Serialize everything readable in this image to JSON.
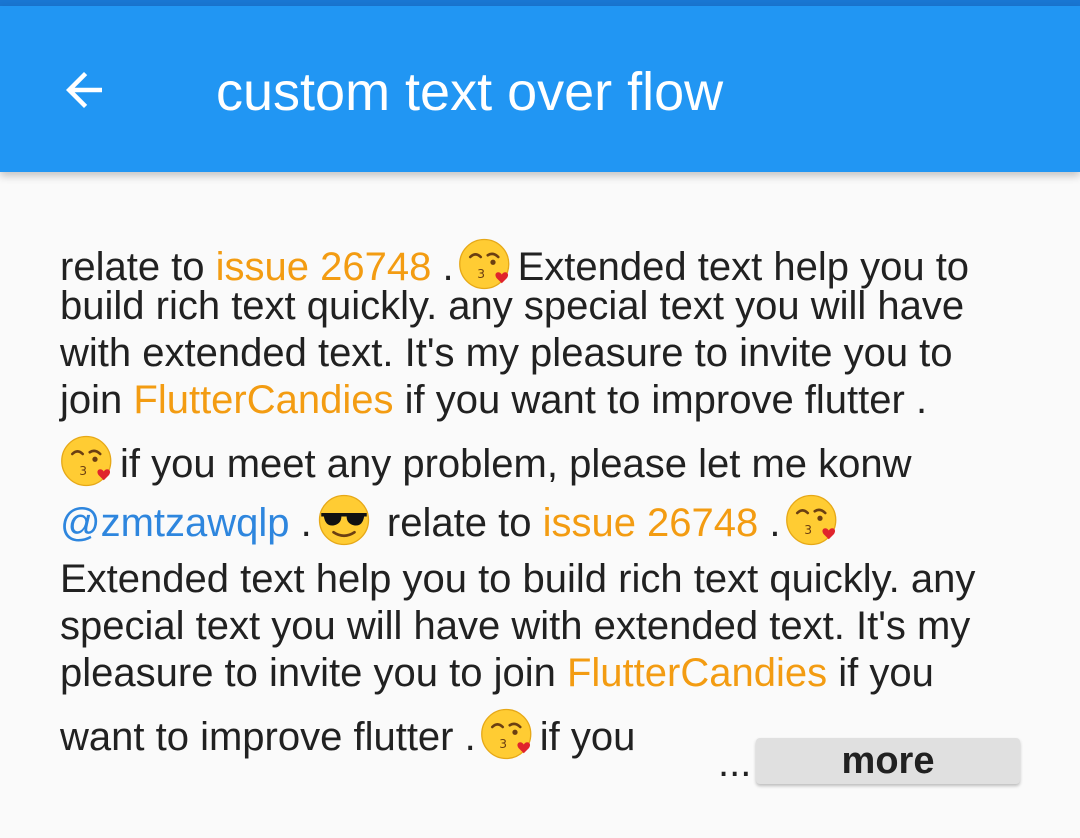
{
  "app_bar": {
    "title": "custom text over flow",
    "back_icon": "arrow-back-icon",
    "color": "#2196f3"
  },
  "content": {
    "text_color": "#212121",
    "link_color_orange": "#f39c12",
    "link_color_blue": "#2e86de",
    "l1_a": "relate to ",
    "l1_link": "issue 26748",
    "l1_b": " .",
    "l1_c": "Extended text help you to",
    "l2": "build rich text quickly. any special text you will have",
    "l3": "with extended text. It's my pleasure to invite you to",
    "l4_a": "join ",
    "l4_link": "FlutterCandies",
    "l4_b": " if you want to improve flutter .",
    "l5_b": "if you meet any problem, please let me konw",
    "l6_mention": "@zmtzawqlp",
    "l6_a": " .",
    "l6_b": " relate to ",
    "l6_link": "issue 26748",
    "l6_c": " .",
    "l7": "Extended text help you to build rich text quickly. any",
    "l8": "special text you will have with extended text. It's my",
    "l9_a": "pleasure to invite you to join ",
    "l9_link": "FlutterCandies",
    "l9_b": " if you",
    "l10_a": "want to improve flutter .",
    "l10_b": "if you",
    "ellipsis": "...",
    "more_label": "more",
    "emoji_kiss": "kissing-face-with-heart-emoji-icon",
    "emoji_cool": "sunglasses-face-emoji-icon"
  }
}
